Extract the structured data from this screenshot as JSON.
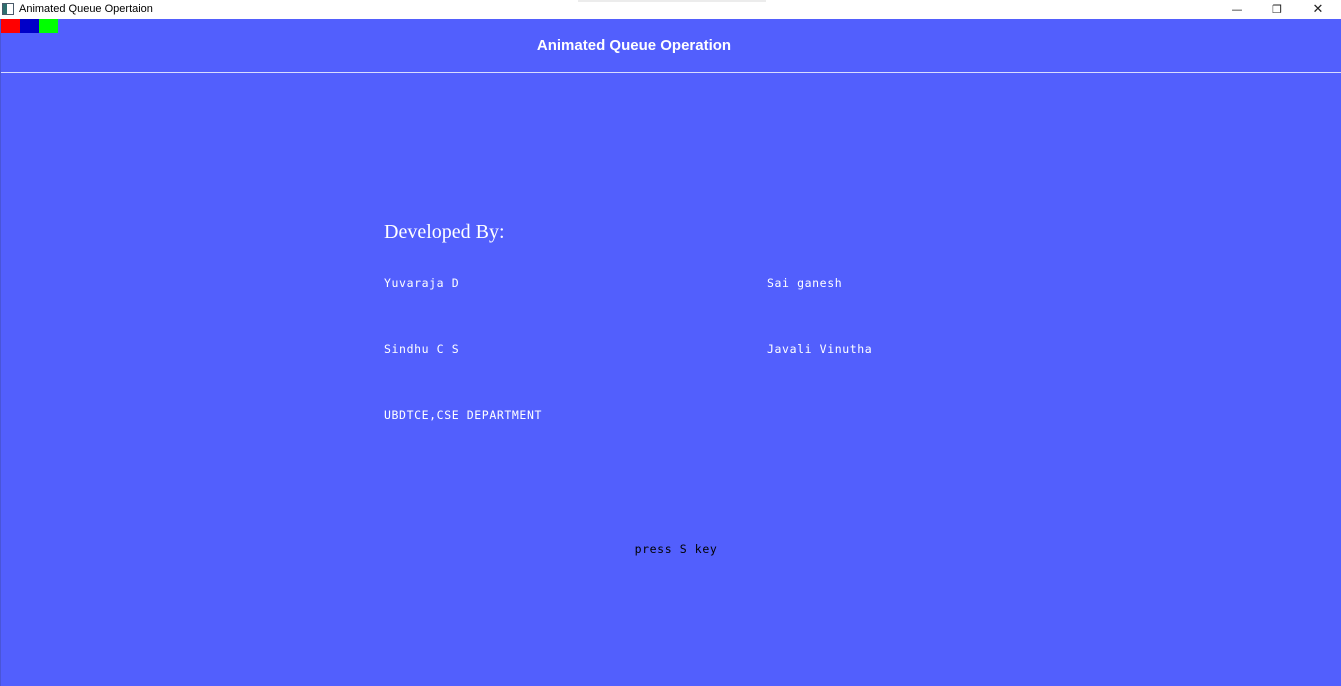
{
  "window": {
    "title": "Animated Queue Opertaion",
    "controls": {
      "minimize": "—",
      "maximize": "❐",
      "close": "✕"
    }
  },
  "palette": {
    "swatches": [
      {
        "name": "red",
        "color": "#ff0000"
      },
      {
        "name": "blue",
        "color": "#0000c8"
      },
      {
        "name": "green",
        "color": "#00ff00"
      }
    ],
    "background": "#525ffd"
  },
  "canvas": {
    "heading": "Animated Queue Operation",
    "developed_by": "Developed By:",
    "developers": [
      "Yuvaraja D",
      "Sai ganesh",
      "Sindhu C S",
      "Javali Vinutha"
    ],
    "department": "UBDTCE,CSE DEPARTMENT",
    "prompt": "press S key"
  }
}
